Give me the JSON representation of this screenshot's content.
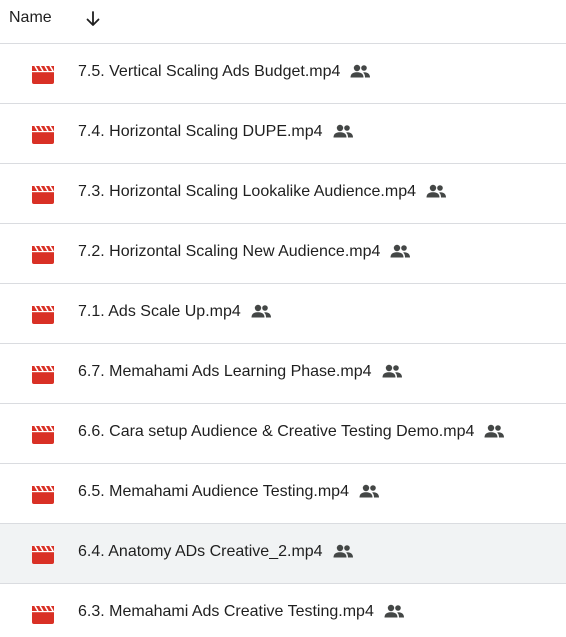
{
  "header": {
    "name_label": "Name",
    "sort_icon": "arrow-down-icon"
  },
  "colors": {
    "video_icon": "#d93025",
    "divider": "#dadce0",
    "selected_row": "#f1f3f4",
    "shared_icon": "#444746"
  },
  "files": [
    {
      "name": "7.5. Vertical Scaling Ads Budget.mp4",
      "icon": "video-file-icon",
      "shared": true,
      "selected": false
    },
    {
      "name": "7.4. Horizontal Scaling DUPE.mp4",
      "icon": "video-file-icon",
      "shared": true,
      "selected": false
    },
    {
      "name": "7.3. Horizontal Scaling Lookalike Audience.mp4",
      "icon": "video-file-icon",
      "shared": true,
      "selected": false
    },
    {
      "name": "7.2. Horizontal Scaling New Audience.mp4",
      "icon": "video-file-icon",
      "shared": true,
      "selected": false
    },
    {
      "name": "7.1. Ads Scale Up.mp4",
      "icon": "video-file-icon",
      "shared": true,
      "selected": false
    },
    {
      "name": "6.7. Memahami Ads Learning Phase.mp4",
      "icon": "video-file-icon",
      "shared": true,
      "selected": false
    },
    {
      "name": "6.6. Cara setup Audience & Creative Testing Demo.mp4",
      "icon": "video-file-icon",
      "shared": true,
      "selected": false
    },
    {
      "name": "6.5. Memahami Audience Testing.mp4",
      "icon": "video-file-icon",
      "shared": true,
      "selected": false
    },
    {
      "name": "6.4. Anatomy ADs Creative_2.mp4",
      "icon": "video-file-icon",
      "shared": true,
      "selected": true
    },
    {
      "name": "6.3. Memahami Ads Creative Testing.mp4",
      "icon": "video-file-icon",
      "shared": true,
      "selected": false
    }
  ]
}
